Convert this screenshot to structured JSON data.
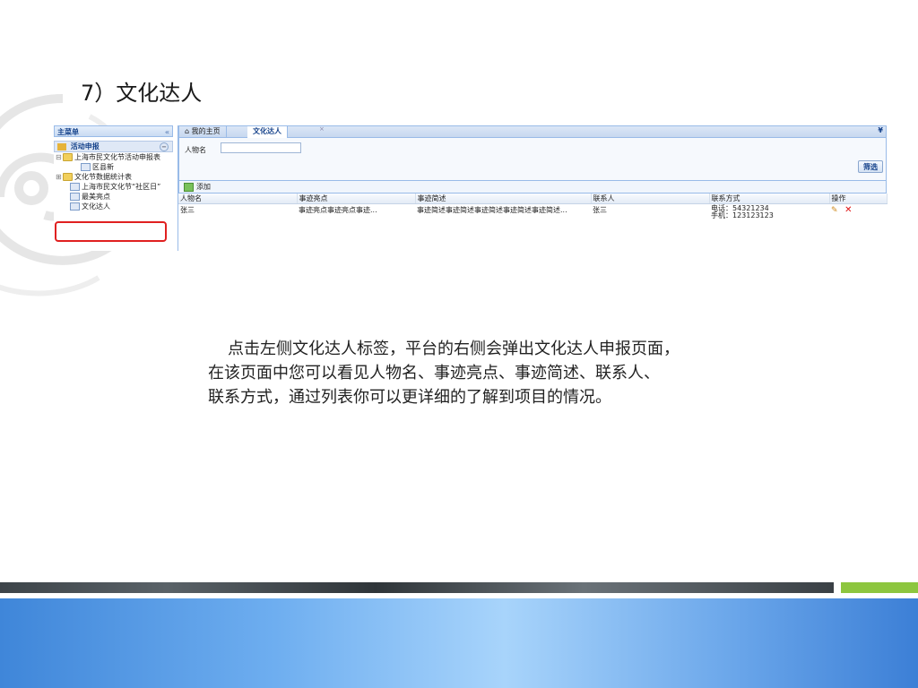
{
  "slide": {
    "title": "7）文化达人",
    "paragraph_lines": [
      "点击左侧文化达人标签，平台的右侧会弹出文化达人申报页面，",
      "在该页面中您可以看见人物名、事迹亮点、事迹简述、联系人、",
      "联系方式，通过列表你可以更详细的了解到项目的情况。"
    ]
  },
  "sidebar": {
    "title": "主菜单",
    "collapse": "«",
    "group": "活动申报",
    "group_toggle": "−",
    "items": [
      {
        "label": "上海市民文化节活动申报表",
        "kind": "folder",
        "expander": "⊟"
      },
      {
        "label": "区县新",
        "kind": "page",
        "expander": ""
      },
      {
        "label": "文化节数据统计表",
        "kind": "folder",
        "expander": "⊞"
      },
      {
        "label": "上海市民文化节“社区日”",
        "kind": "page",
        "expander": ""
      },
      {
        "label": "最美亮点",
        "kind": "page",
        "expander": ""
      },
      {
        "label": "文化达人",
        "kind": "page",
        "expander": ""
      }
    ]
  },
  "tabs": [
    {
      "label": "⌂ 我的主页"
    },
    {
      "label": "文化达人"
    }
  ],
  "tab_close": "×",
  "tab_menu": "¥",
  "filter": {
    "label": "人物名",
    "value": "",
    "button": "筛选"
  },
  "toolbar": {
    "add": "添加"
  },
  "grid": {
    "columns": [
      "人物名",
      "事迹亮点",
      "事迹简述",
      "联系人",
      "联系方式",
      "操作"
    ],
    "rows": [
      {
        "name": "张三",
        "highlight": "事迹亮点事迹亮点事迹...",
        "summary": "事迹简述事迹简述事迹简述事迹简述事迹简述...",
        "contact": "张三",
        "phone": "电话：54321234",
        "mobile": "手机：123123123"
      }
    ],
    "edit_icon": "✎",
    "delete_icon": "✕"
  },
  "colors": {
    "accent": "#15428b",
    "highlight_box": "#e02020",
    "footer_green": "#8dc63f",
    "footer_blue": "#6eaef0"
  }
}
